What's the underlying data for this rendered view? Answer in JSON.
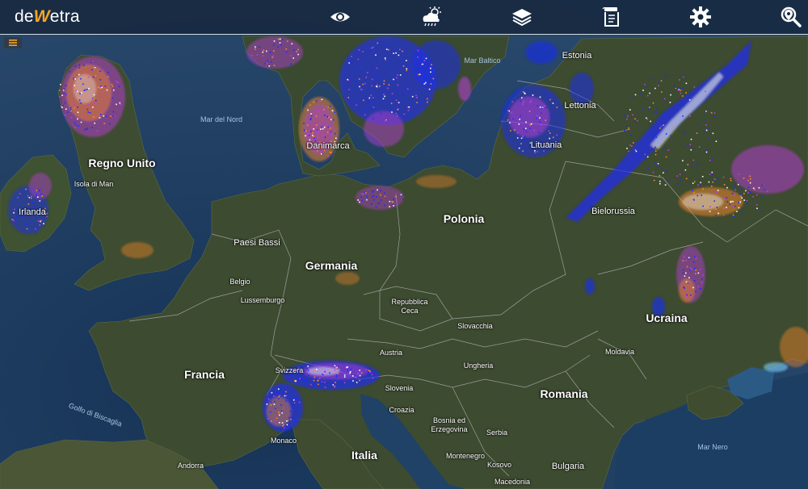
{
  "app": {
    "logo_prefix": "de",
    "logo_accent": "W",
    "logo_suffix": "etra",
    "accent_color": "#f5a623",
    "topbar_color": "#16263c"
  },
  "toolbar": {
    "buttons": [
      {
        "name": "eye-icon"
      },
      {
        "name": "weather-cloud-icon"
      },
      {
        "name": "layers-icon"
      },
      {
        "name": "documents-icon"
      },
      {
        "name": "gear-icon"
      },
      {
        "name": "search-location-icon"
      }
    ]
  },
  "menu_button": {
    "icon": "hamburger-icon"
  },
  "map_labels": {
    "estonia": "Estonia",
    "mar_baltico": "Mar Baltico",
    "lettonia": "Lettonia",
    "mar_del_nord": "Mar del Nord",
    "danimarca": "Danimarca",
    "lituania": "Lituania",
    "regno_unito": "Regno Unito",
    "isola_di_man": "Isola di Man",
    "irlanda": "Irlanda",
    "polonia": "Polonia",
    "bielorussia": "Bielorussia",
    "paesi_bassi": "Paesi Bassi",
    "germania": "Germania",
    "belgio": "Belgio",
    "lussemburgo": "Lussemburgo",
    "repubblica_ceca": [
      "Repubblica",
      "Ceca"
    ],
    "ucraina": "Ucraina",
    "slovacchia": "Slovacchia",
    "austria": "Austria",
    "moldavia": "Moldavia",
    "francia": "Francia",
    "svizzera": "Svizzera",
    "ungheria": "Ungheria",
    "slovenia": "Slovenia",
    "romania": "Romania",
    "golfo_di_biscaglia": "Golfo di Biscaglia",
    "croazia": "Croazia",
    "bosnia": [
      "Bosnia ed",
      "Erzegovina"
    ],
    "serbia": "Serbia",
    "monaco": "Monaco",
    "mar_nero": "Mar Nero",
    "italia": "Italia",
    "montenegro": "Montenegro",
    "kosovo": "Kosovo",
    "bulgaria": "Bulgaria",
    "andorra": "Andorra",
    "macedonia": "Macedonia"
  },
  "colors": {
    "sea": "#1d3b5c",
    "land": "#3c4a2e",
    "radar_blue": "#1a2cff",
    "radar_magenta": "#c040e0",
    "radar_orange": "#ff8a2a",
    "radar_white": "#ffffff"
  }
}
